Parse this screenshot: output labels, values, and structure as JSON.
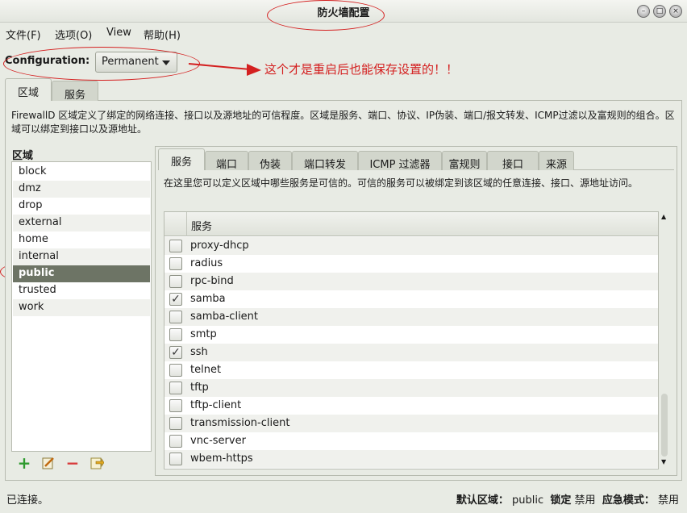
{
  "window": {
    "title": "防火墙配置",
    "controls": [
      "minimize",
      "maximize",
      "close"
    ]
  },
  "menu": {
    "items": [
      "文件(F)",
      "选项(O)",
      "View",
      "帮助(H)"
    ]
  },
  "config": {
    "label": "Configuration:",
    "value": "Permanent"
  },
  "annotation": {
    "text": "这个才是重启后也能保存设置的！！"
  },
  "outer_tabs": [
    {
      "label": "区域",
      "active": true
    },
    {
      "label": "服务",
      "active": false
    }
  ],
  "zone_description": "FirewallD 区域定义了绑定的网络连接、接口以及源地址的可信程度。区域是服务、端口、协议、IP伪装、端口/报文转发、ICMP过滤以及富规则的组合。区域可以绑定到接口以及源地址。",
  "zones": {
    "heading": "区域",
    "items": [
      "block",
      "dmz",
      "drop",
      "external",
      "home",
      "internal",
      "public",
      "trusted",
      "work"
    ],
    "selected": "public"
  },
  "zone_tools": [
    "add-icon",
    "edit-icon",
    "remove-icon",
    "load-defaults-icon"
  ],
  "inner_tabs": [
    {
      "label": "服务",
      "active": true
    },
    {
      "label": "端口",
      "active": false
    },
    {
      "label": "伪装",
      "active": false
    },
    {
      "label": "端口转发",
      "active": false
    },
    {
      "label": "ICMP 过滤器",
      "active": false
    },
    {
      "label": "富规则",
      "active": false
    },
    {
      "label": "接口",
      "active": false
    },
    {
      "label": "来源",
      "active": false
    }
  ],
  "services": {
    "description": "在这里您可以定义区域中哪些服务是可信的。可信的服务可以被绑定到该区域的任意连接、接口、源地址访问。",
    "column_header": "服务",
    "rows": [
      {
        "name": "proxy-dhcp",
        "checked": false
      },
      {
        "name": "radius",
        "checked": false
      },
      {
        "name": "rpc-bind",
        "checked": false
      },
      {
        "name": "samba",
        "checked": true
      },
      {
        "name": "samba-client",
        "checked": false
      },
      {
        "name": "smtp",
        "checked": false
      },
      {
        "name": "ssh",
        "checked": true
      },
      {
        "name": "telnet",
        "checked": false
      },
      {
        "name": "tftp",
        "checked": false
      },
      {
        "name": "tftp-client",
        "checked": false
      },
      {
        "name": "transmission-client",
        "checked": false
      },
      {
        "name": "vnc-server",
        "checked": false
      },
      {
        "name": "wbem-https",
        "checked": false
      }
    ]
  },
  "status": {
    "connection": "已连接。",
    "default_zone_label": "默认区域：",
    "default_zone_value": "public",
    "lockdown_label": "锁定",
    "lockdown_value": "禁用",
    "panic_label": "应急模式：",
    "panic_value": "禁用"
  },
  "colors": {
    "annotation": "#d42020",
    "selection": "#6d7465"
  }
}
